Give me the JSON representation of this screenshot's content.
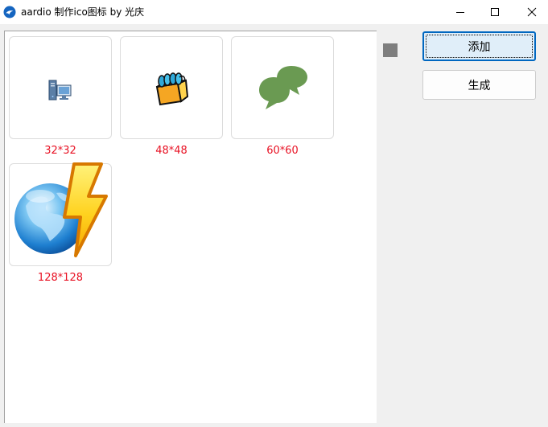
{
  "window": {
    "title": "aardio 制作ico图标 by 光庆",
    "controls": {
      "minimize": "minimize-icon",
      "maximize": "maximize-icon",
      "close": "close-icon"
    }
  },
  "previews": [
    {
      "label": "32*32",
      "icon": "computer-icon"
    },
    {
      "label": "48*48",
      "icon": "box-icon"
    },
    {
      "label": "60*60",
      "icon": "chat-bubbles-icon"
    },
    {
      "label": "128*128",
      "icon": "globe-lightning-icon"
    }
  ],
  "swatch": {
    "color": "#7e7e7e"
  },
  "buttons": {
    "add": "添加",
    "generate": "生成"
  },
  "colors": {
    "size_label": "#e81123",
    "focus_border": "#0067c0"
  }
}
